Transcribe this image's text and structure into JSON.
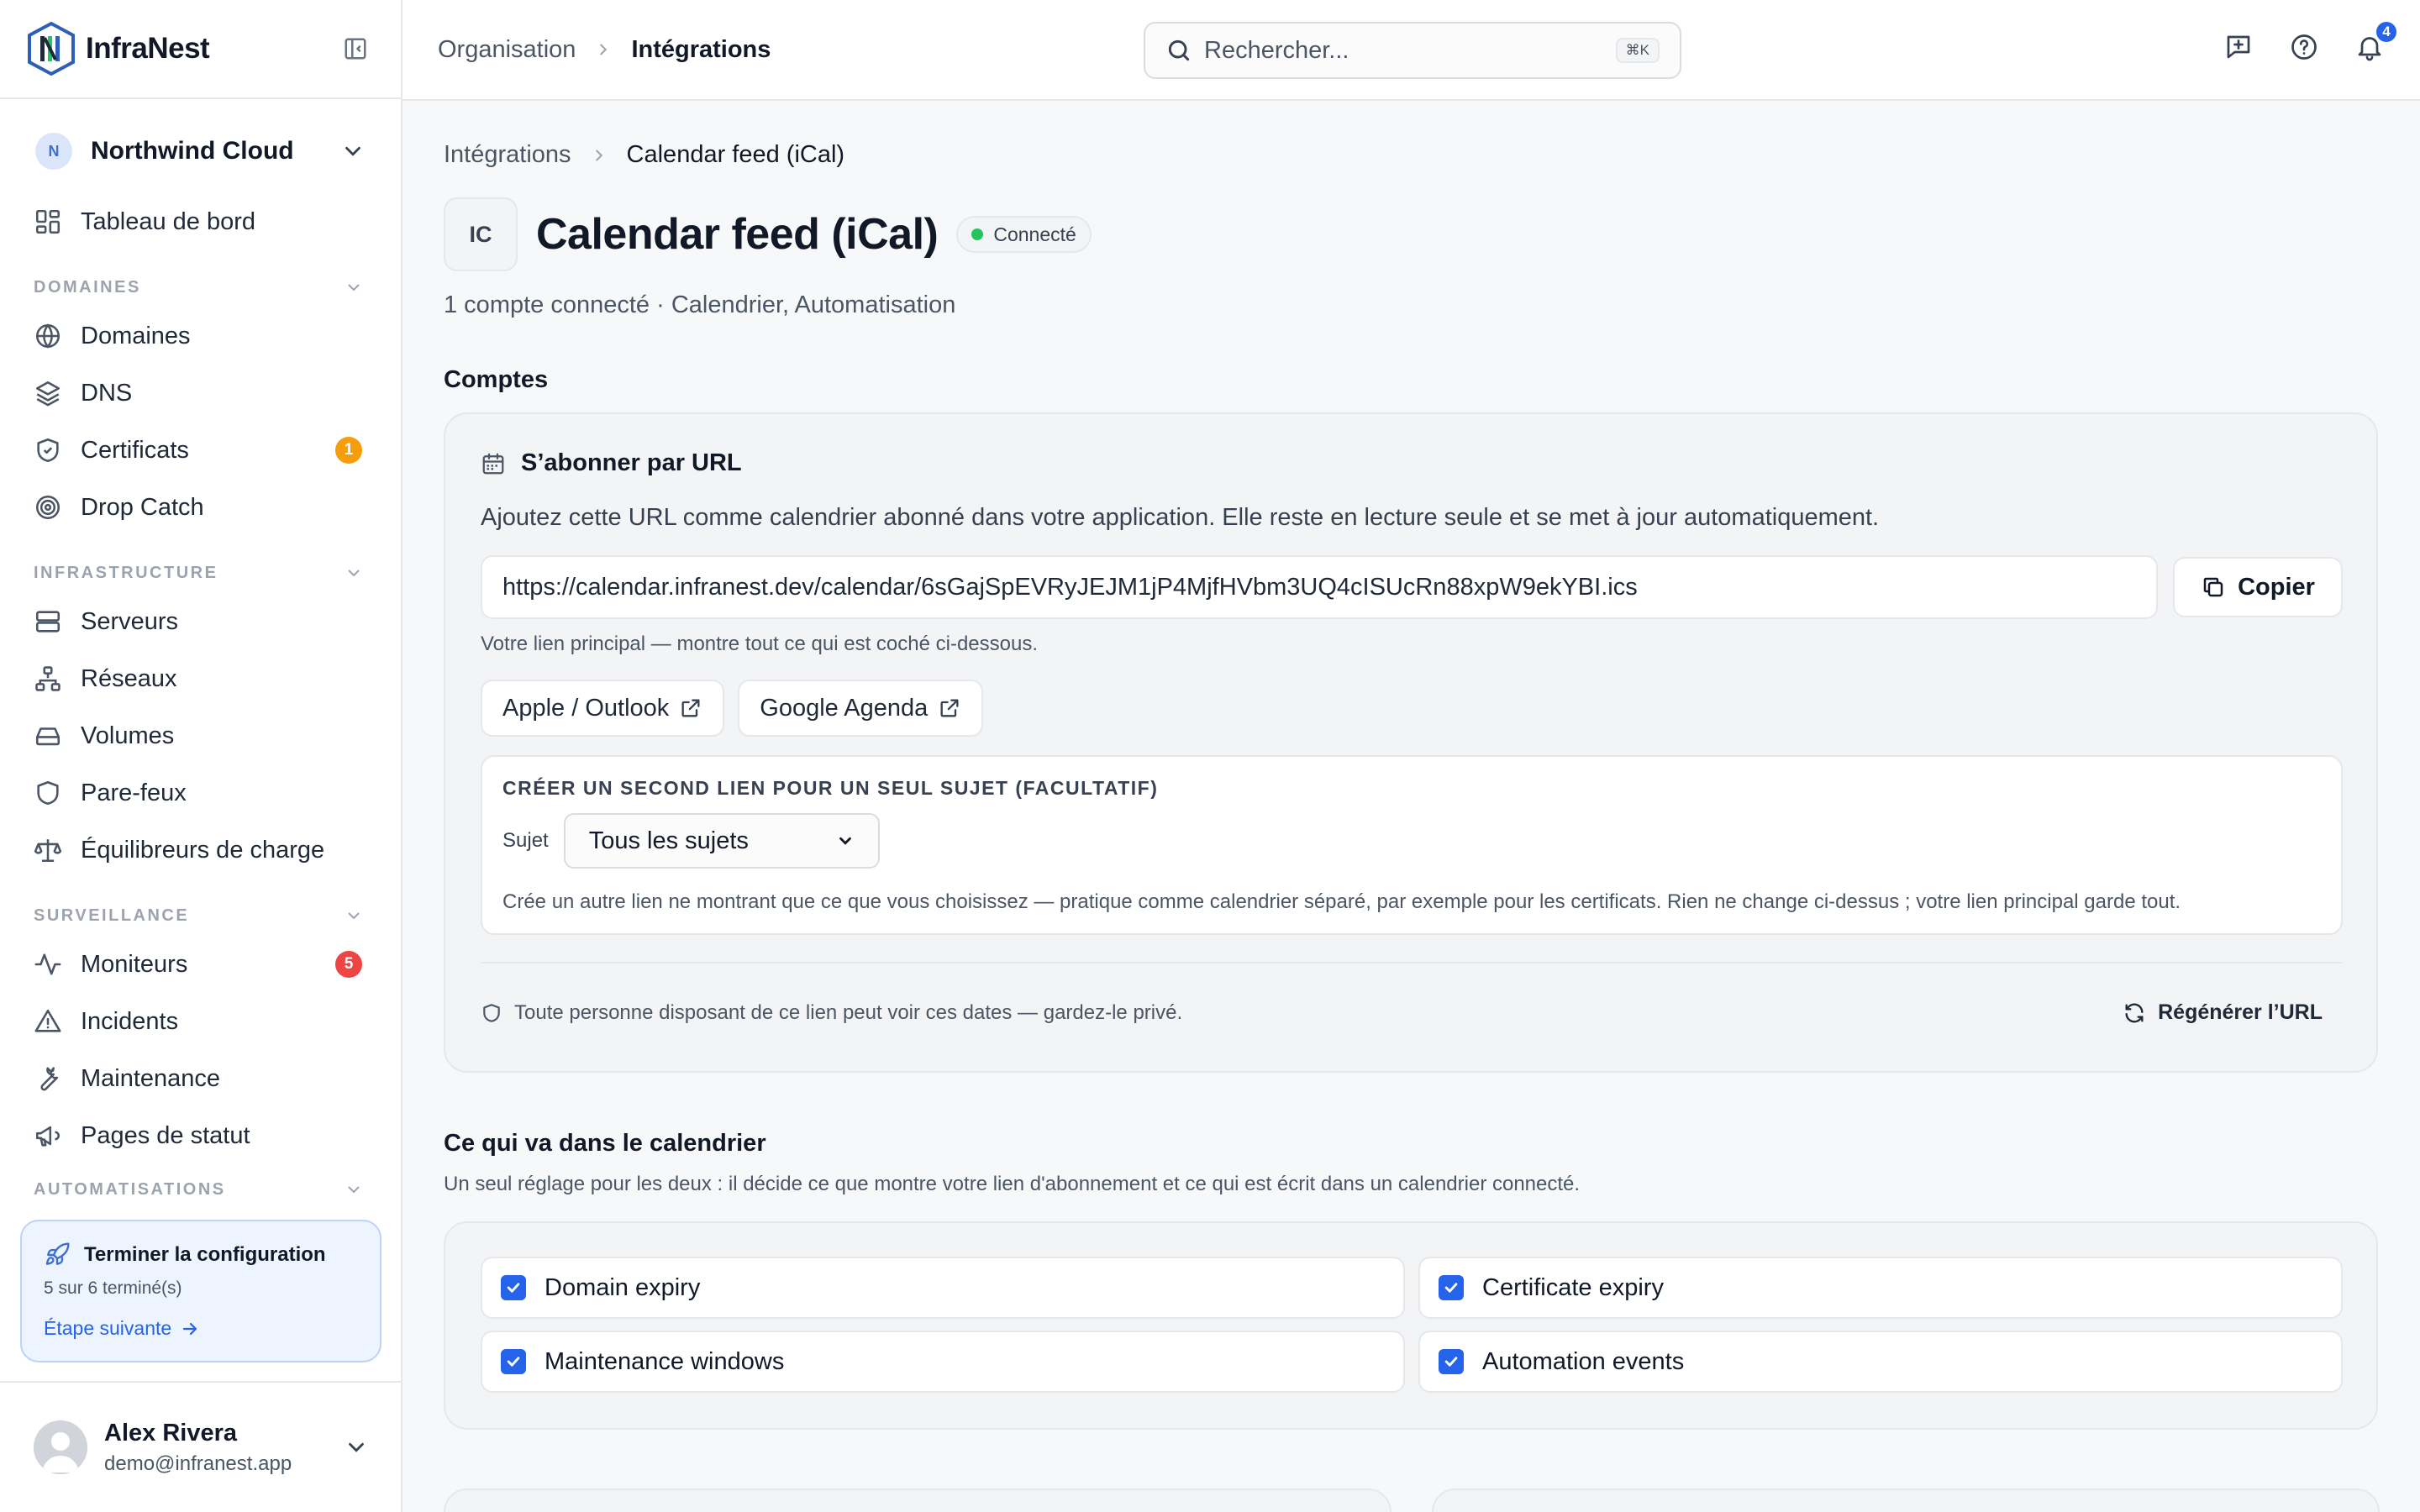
{
  "app": {
    "name": "InfraNest"
  },
  "sidebar": {
    "org": {
      "initial": "N",
      "name": "Northwind Cloud"
    },
    "dashboard": "Tableau de bord",
    "sections": {
      "domains": "DOMAINES",
      "infrastructure": "INFRASTRUCTURE",
      "monitoring": "SURVEILLANCE",
      "automations": "AUTOMATISATIONS"
    },
    "items": {
      "domaines": "Domaines",
      "dns": "DNS",
      "certificats": "Certificats",
      "certificats_badge": "1",
      "drop_catch": "Drop Catch",
      "serveurs": "Serveurs",
      "reseaux": "Réseaux",
      "volumes": "Volumes",
      "pare_feux": "Pare-feux",
      "equilibreurs": "Équilibreurs de charge",
      "moniteurs": "Moniteurs",
      "moniteurs_badge": "5",
      "incidents": "Incidents",
      "maintenance": "Maintenance",
      "pages_statut": "Pages de statut"
    },
    "setup": {
      "title": "Terminer la configuration",
      "progress": "5 sur 6 terminé(s)",
      "next": "Étape suivante"
    },
    "user": {
      "name": "Alex Rivera",
      "email": "demo@infranest.app"
    }
  },
  "topbar": {
    "crumb_parent": "Organisation",
    "crumb_current": "Intégrations",
    "search_placeholder": "Rechercher...",
    "search_shortcut": "⌘K",
    "notifications_count": "4"
  },
  "page": {
    "crumb_parent": "Intégrations",
    "crumb_current": "Calendar feed (iCal)",
    "icon_initials": "IC",
    "title": "Calendar feed (iCal)",
    "status": "Connecté",
    "meta": "1 compte connecté · Calendrier, Automatisation"
  },
  "accounts": {
    "title": "Comptes",
    "subscribe_title": "S’abonner par URL",
    "description": "Ajoutez cette URL comme calendrier abonné dans votre application. Elle reste en lecture seule et se met à jour automatiquement.",
    "url": "https://calendar.infranest.dev/calendar/6sGajSpEVRyJEJM1jP4MjfHVbm3UQ4cISUcRn88xpW9ekYBI.ics",
    "copy_label": "Copier",
    "hint": "Votre lien principal — montre tout ce qui est coché ci-dessous.",
    "apple_outlook": "Apple / Outlook",
    "google": "Google Agenda",
    "second_title": "CRÉER UN SECOND LIEN POUR UN SEUL SUJET (FACULTATIF)",
    "subject_label": "Sujet",
    "subject_value": "Tous les sujets",
    "second_desc": "Crée un autre lien ne montrant que ce que vous choisissez — pratique comme calendrier séparé, par exemple pour les certificats. Rien ne change ci-dessus ; votre lien principal garde tout.",
    "privacy_note": "Toute personne disposant de ce lien peut voir ces dates — gardez-le privé.",
    "regen_label": "Régénérer l’URL"
  },
  "calendar": {
    "title": "Ce qui va dans le calendrier",
    "description": "Un seul réglage pour les deux : il décide ce que montre votre lien d'abonnement et ce qui est écrit dans un calendrier connecté.",
    "options": [
      {
        "label": "Domain expiry",
        "checked": true
      },
      {
        "label": "Certificate expiry",
        "checked": true
      },
      {
        "label": "Maintenance windows",
        "checked": true
      },
      {
        "label": "Automation events",
        "checked": true
      }
    ]
  },
  "colors": {
    "accent": "#2563eb",
    "status_green": "#22c55e",
    "badge_orange": "#f59e0b",
    "badge_red": "#ef4444"
  }
}
